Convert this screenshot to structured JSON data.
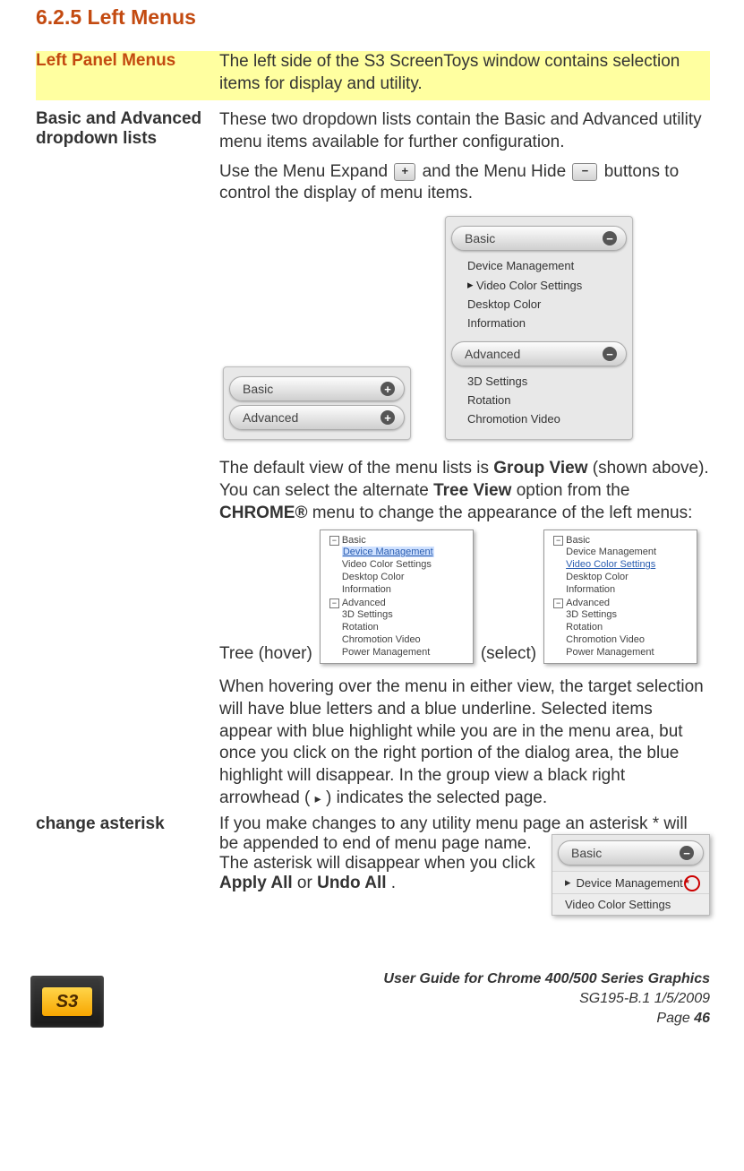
{
  "heading": "6.2.5 Left Menus",
  "rows": {
    "left_panel": {
      "label": "Left Panel Menus",
      "body": "The left side of the S3 ScreenToys window contains selection items for display and utility."
    },
    "dropdowns": {
      "label": "Basic and Advanced dropdown lists",
      "p1": "These two dropdown lists contain the Basic and Advanced utility menu items available for further configuration.",
      "p2a": "Use the Menu Expand ",
      "p2b": "and the Menu Hide ",
      "p2c": " buttons to control the display of menu items.",
      "group_basic": "Basic",
      "group_advanced": "Advanced",
      "basic_items": [
        "Device Management",
        "Video Color Settings",
        "Desktop Color",
        "Information"
      ],
      "advanced_items": [
        "3D Settings",
        "Rotation",
        "Chromotion Video"
      ],
      "p3a": "The default view of the menu lists is ",
      "p3b": "Group View",
      "p3c": " (shown above). You can select the alternate ",
      "p3d": "Tree View",
      "p3e": " option from the ",
      "p3f": "CHROME®",
      "p3g": " menu to change the appearance of the left menus:",
      "tree_caption_hover": "Tree (hover)",
      "tree_caption_select": "(select)",
      "tree_basic": "Basic",
      "tree_advanced": "Advanced",
      "tree_basic_items": [
        "Device Management",
        "Video Color Settings",
        "Desktop Color",
        "Information"
      ],
      "tree_adv_items": [
        "3D Settings",
        "Rotation",
        "Chromotion Video",
        "Power Management"
      ],
      "p4a": "When hovering over the menu in either view, the target selection will have blue letters and a blue underline. Selected items appear with blue highlight while you are in the menu area, but once you click on the right portion of the dialog area, the blue highlight will disappear. In the group view a black right arrowhead (",
      "p4b": ") indicates the selected page."
    },
    "asterisk": {
      "label": "change asterisk",
      "p1": "If you make changes to any utility menu page an ",
      "p2a": "asterisk * will be appended to end of menu page name. The asterisk will disappear when you click ",
      "p2b": "Apply All",
      "p2c": " or ",
      "p2d": "Undo All",
      "p2e": ".",
      "panel_basic": "Basic",
      "panel_item_marked": "Device Management",
      "panel_item_marked_star": "*",
      "panel_item2": "Video Color Settings"
    }
  },
  "icons": {
    "expand": "+",
    "collapse": "−",
    "arrow": "▸"
  },
  "footer": {
    "logo": "S3",
    "line1": "User Guide for Chrome 400/500 Series Graphics",
    "line2": "SG195-B.1   1/5/2009",
    "line3a": "Page ",
    "line3b": "46"
  }
}
